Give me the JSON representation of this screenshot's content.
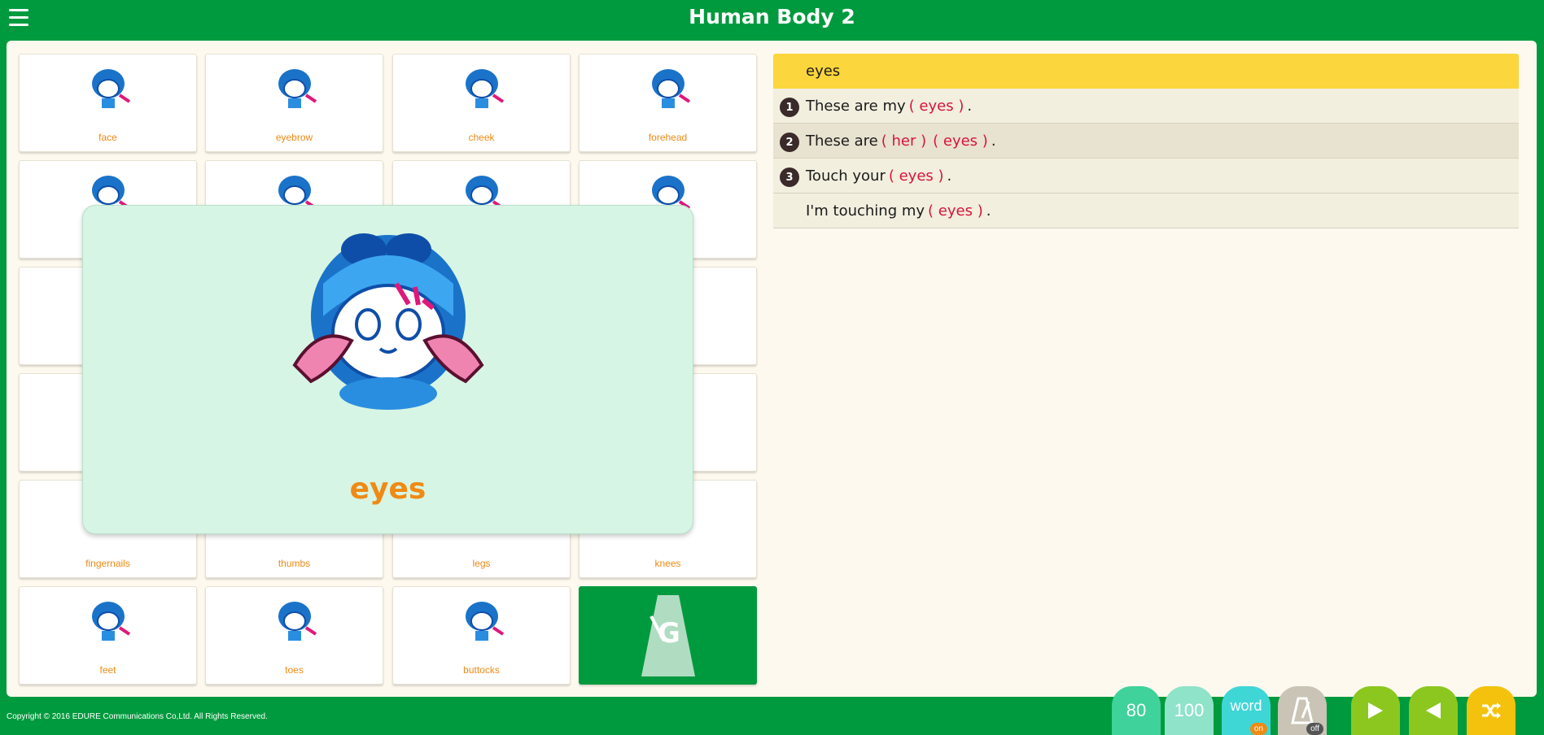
{
  "header": {
    "title": "Human Body 2",
    "menu_icon": "hamburger-icon"
  },
  "grid": {
    "cards": [
      {
        "label": "face"
      },
      {
        "label": "eyebrow"
      },
      {
        "label": "cheek"
      },
      {
        "label": "forehead"
      },
      {
        "label": ""
      },
      {
        "label": ""
      },
      {
        "label": ""
      },
      {
        "label": ""
      },
      {
        "label": ""
      },
      {
        "label": ""
      },
      {
        "label": ""
      },
      {
        "label": ""
      },
      {
        "label": ""
      },
      {
        "label": ""
      },
      {
        "label": ""
      },
      {
        "label": ""
      },
      {
        "label": "fingernails"
      },
      {
        "label": "thumbs"
      },
      {
        "label": "legs"
      },
      {
        "label": "knees"
      },
      {
        "label": "feet"
      },
      {
        "label": "toes"
      },
      {
        "label": "buttocks"
      },
      {
        "label": "",
        "icon": "metronome-icon",
        "letter": "G"
      }
    ]
  },
  "popup": {
    "word": "eyes"
  },
  "sentences": {
    "header": "eyes",
    "rows": [
      {
        "num": "1",
        "pre": "These are my",
        "answers": [
          "( eyes )"
        ],
        "post": "."
      },
      {
        "num": "2",
        "pre": "These are",
        "answers": [
          "( her )",
          "( eyes )"
        ],
        "post": "."
      },
      {
        "num": "3",
        "pre": "Touch your",
        "answers": [
          "( eyes )"
        ],
        "post": "."
      },
      {
        "num": "",
        "pre": "I'm touching my",
        "answers": [
          "( eyes )"
        ],
        "post": "."
      }
    ]
  },
  "footer": {
    "copyright": "Copyright © 2016 EDURE Communications Co,Ltd. All Rights Reserved.",
    "speed_80": "80",
    "speed_100": "100",
    "word_label": "word",
    "word_state": "on",
    "metronome_state": "off",
    "colors": {
      "c80": "#3fd29a",
      "c100": "#8fe3c8",
      "word": "#3fd6d6",
      "metro": "#c9c4b6",
      "play": "#8cc720",
      "back": "#8cc720",
      "shuffle": "#f4c20d",
      "on": "#ef8a14",
      "off": "#555555"
    }
  }
}
